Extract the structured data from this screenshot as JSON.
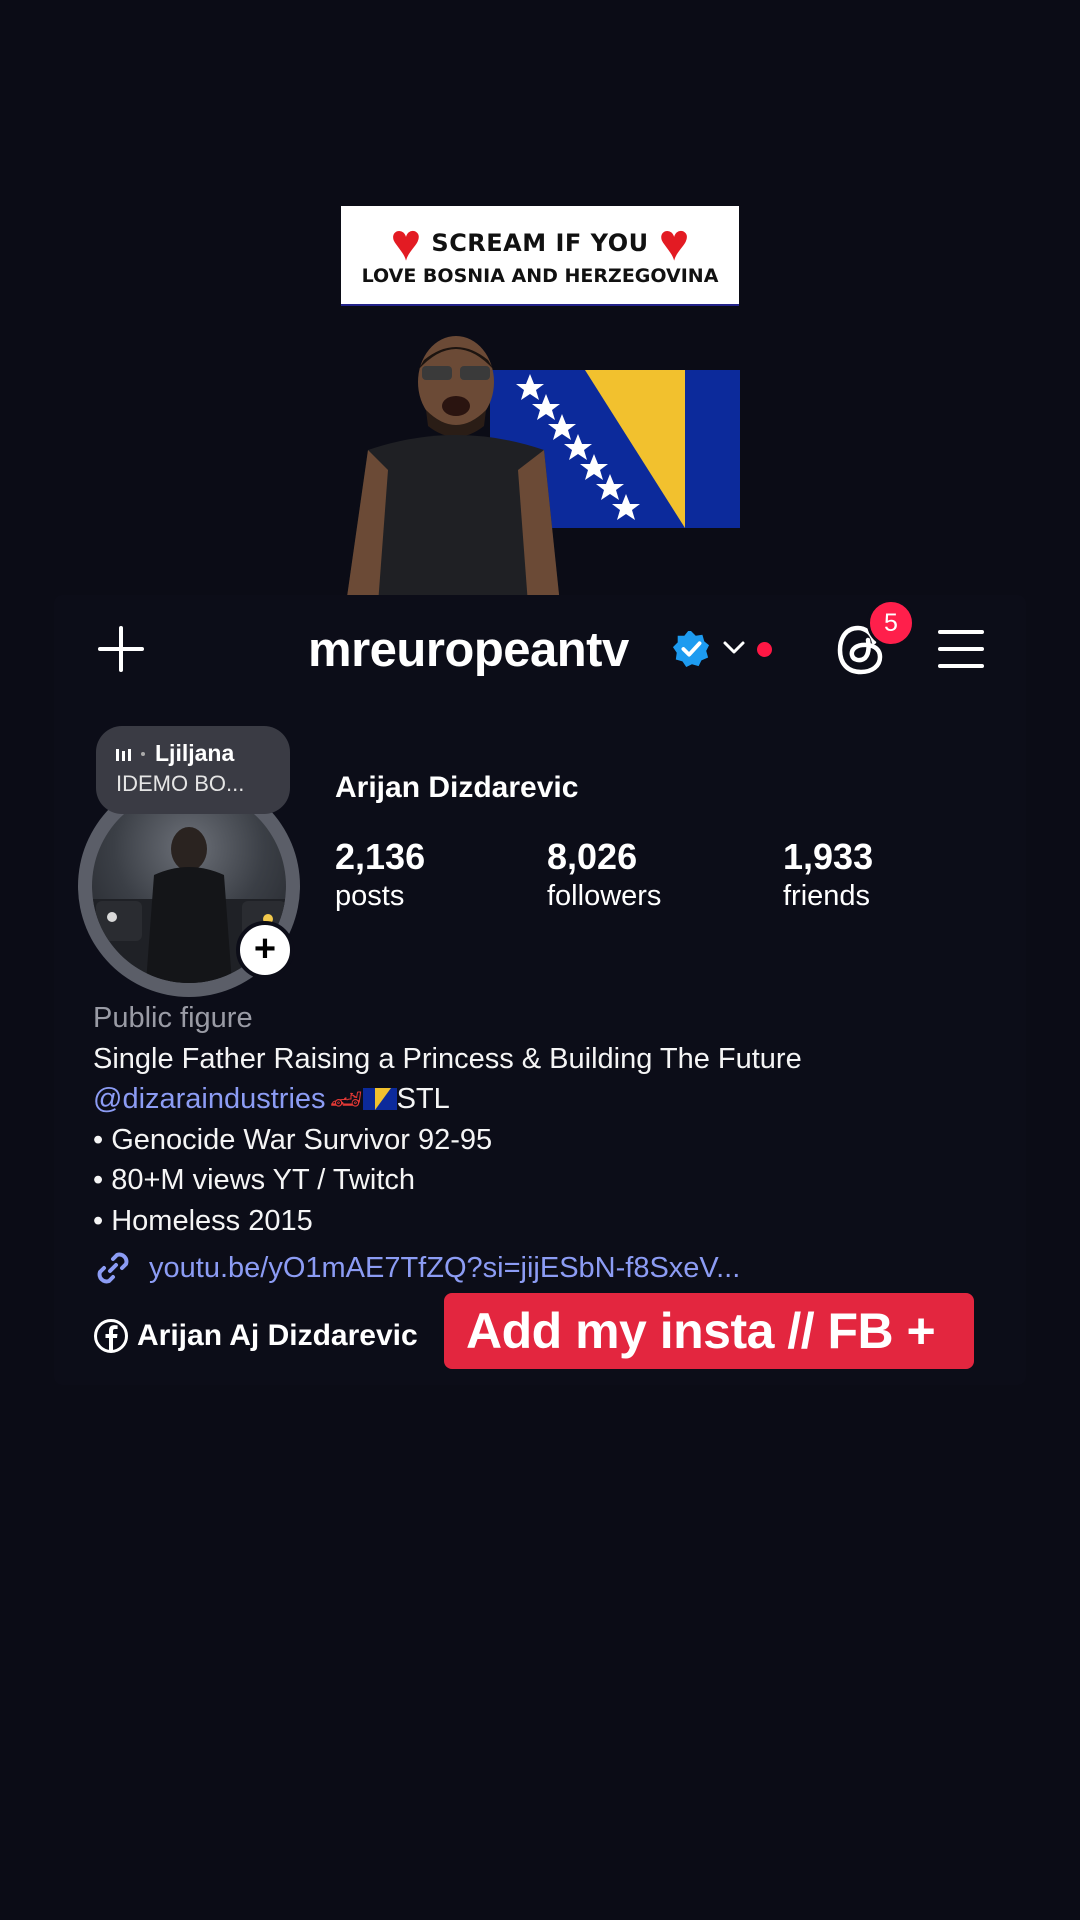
{
  "stickers": {
    "banner_line1": "SCREAM IF YOU",
    "banner_line2": "LOVE BOSNIA AND HERZEGOVINA"
  },
  "header": {
    "username": "mreuropeantv",
    "notification_count": "5"
  },
  "profile": {
    "note_author": "Ljiljana",
    "note_text": "IDEMO BO...",
    "full_name": "Arijan Dizdarevic",
    "stats": [
      {
        "number": "2,136",
        "label": "posts"
      },
      {
        "number": "8,026",
        "label": "followers"
      },
      {
        "number": "1,933",
        "label": "friends"
      }
    ],
    "category": "Public figure",
    "bio_line1": "Single Father Raising a Princess & Building The Future",
    "bio_mention": "@dizaraindustries",
    "bio_mention_suffix": "STL",
    "bio_bullets": [
      "• Genocide War Survivor 92-95",
      "• 80+M views YT / Twitch",
      "• Homeless 2015"
    ],
    "link": "youtu.be/yO1mAE7TfZQ?si=jijESbN-f8SxeV...",
    "facebook_name": "Arijan Aj Dizdarevic"
  },
  "overlay": {
    "cta_text": "Add my insta // FB +"
  },
  "colors": {
    "background": "#0b0c16",
    "link_blue": "#8c9cf4",
    "verified_blue": "#1d9bf0",
    "badge_red": "#ff1f4b",
    "cta_red": "#e3263f"
  },
  "icons": [
    "plus-icon",
    "verified-icon",
    "chevron-down-icon",
    "threads-icon",
    "menu-icon",
    "link-icon",
    "facebook-icon",
    "heart-icon",
    "music-bars-icon"
  ]
}
